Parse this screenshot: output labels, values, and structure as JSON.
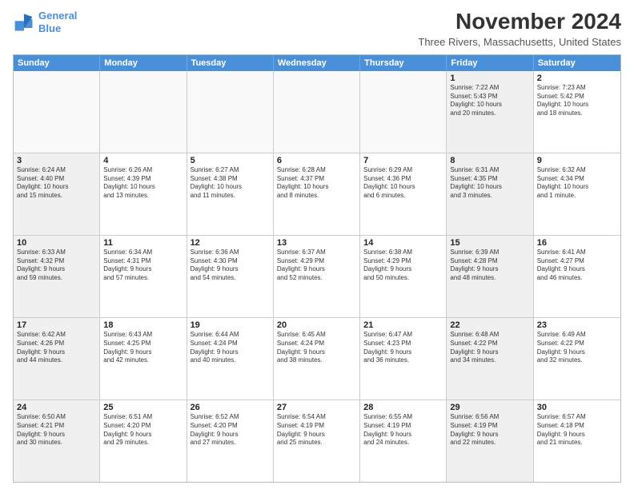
{
  "logo": {
    "line1": "General",
    "line2": "Blue"
  },
  "title": "November 2024",
  "location": "Three Rivers, Massachusetts, United States",
  "weekdays": [
    "Sunday",
    "Monday",
    "Tuesday",
    "Wednesday",
    "Thursday",
    "Friday",
    "Saturday"
  ],
  "rows": [
    [
      {
        "day": "",
        "info": "",
        "shaded": false
      },
      {
        "day": "",
        "info": "",
        "shaded": false
      },
      {
        "day": "",
        "info": "",
        "shaded": false
      },
      {
        "day": "",
        "info": "",
        "shaded": false
      },
      {
        "day": "",
        "info": "",
        "shaded": false
      },
      {
        "day": "1",
        "info": "Sunrise: 7:22 AM\nSunset: 5:43 PM\nDaylight: 10 hours\nand 20 minutes.",
        "shaded": true
      },
      {
        "day": "2",
        "info": "Sunrise: 7:23 AM\nSunset: 5:42 PM\nDaylight: 10 hours\nand 18 minutes.",
        "shaded": false
      }
    ],
    [
      {
        "day": "3",
        "info": "Sunrise: 6:24 AM\nSunset: 4:40 PM\nDaylight: 10 hours\nand 15 minutes.",
        "shaded": true
      },
      {
        "day": "4",
        "info": "Sunrise: 6:26 AM\nSunset: 4:39 PM\nDaylight: 10 hours\nand 13 minutes.",
        "shaded": false
      },
      {
        "day": "5",
        "info": "Sunrise: 6:27 AM\nSunset: 4:38 PM\nDaylight: 10 hours\nand 11 minutes.",
        "shaded": false
      },
      {
        "day": "6",
        "info": "Sunrise: 6:28 AM\nSunset: 4:37 PM\nDaylight: 10 hours\nand 8 minutes.",
        "shaded": false
      },
      {
        "day": "7",
        "info": "Sunrise: 6:29 AM\nSunset: 4:36 PM\nDaylight: 10 hours\nand 6 minutes.",
        "shaded": false
      },
      {
        "day": "8",
        "info": "Sunrise: 6:31 AM\nSunset: 4:35 PM\nDaylight: 10 hours\nand 3 minutes.",
        "shaded": true
      },
      {
        "day": "9",
        "info": "Sunrise: 6:32 AM\nSunset: 4:34 PM\nDaylight: 10 hours\nand 1 minute.",
        "shaded": false
      }
    ],
    [
      {
        "day": "10",
        "info": "Sunrise: 6:33 AM\nSunset: 4:32 PM\nDaylight: 9 hours\nand 59 minutes.",
        "shaded": true
      },
      {
        "day": "11",
        "info": "Sunrise: 6:34 AM\nSunset: 4:31 PM\nDaylight: 9 hours\nand 57 minutes.",
        "shaded": false
      },
      {
        "day": "12",
        "info": "Sunrise: 6:36 AM\nSunset: 4:30 PM\nDaylight: 9 hours\nand 54 minutes.",
        "shaded": false
      },
      {
        "day": "13",
        "info": "Sunrise: 6:37 AM\nSunset: 4:29 PM\nDaylight: 9 hours\nand 52 minutes.",
        "shaded": false
      },
      {
        "day": "14",
        "info": "Sunrise: 6:38 AM\nSunset: 4:29 PM\nDaylight: 9 hours\nand 50 minutes.",
        "shaded": false
      },
      {
        "day": "15",
        "info": "Sunrise: 6:39 AM\nSunset: 4:28 PM\nDaylight: 9 hours\nand 48 minutes.",
        "shaded": true
      },
      {
        "day": "16",
        "info": "Sunrise: 6:41 AM\nSunset: 4:27 PM\nDaylight: 9 hours\nand 46 minutes.",
        "shaded": false
      }
    ],
    [
      {
        "day": "17",
        "info": "Sunrise: 6:42 AM\nSunset: 4:26 PM\nDaylight: 9 hours\nand 44 minutes.",
        "shaded": true
      },
      {
        "day": "18",
        "info": "Sunrise: 6:43 AM\nSunset: 4:25 PM\nDaylight: 9 hours\nand 42 minutes.",
        "shaded": false
      },
      {
        "day": "19",
        "info": "Sunrise: 6:44 AM\nSunset: 4:24 PM\nDaylight: 9 hours\nand 40 minutes.",
        "shaded": false
      },
      {
        "day": "20",
        "info": "Sunrise: 6:45 AM\nSunset: 4:24 PM\nDaylight: 9 hours\nand 38 minutes.",
        "shaded": false
      },
      {
        "day": "21",
        "info": "Sunrise: 6:47 AM\nSunset: 4:23 PM\nDaylight: 9 hours\nand 36 minutes.",
        "shaded": false
      },
      {
        "day": "22",
        "info": "Sunrise: 6:48 AM\nSunset: 4:22 PM\nDaylight: 9 hours\nand 34 minutes.",
        "shaded": true
      },
      {
        "day": "23",
        "info": "Sunrise: 6:49 AM\nSunset: 4:22 PM\nDaylight: 9 hours\nand 32 minutes.",
        "shaded": false
      }
    ],
    [
      {
        "day": "24",
        "info": "Sunrise: 6:50 AM\nSunset: 4:21 PM\nDaylight: 9 hours\nand 30 minutes.",
        "shaded": true
      },
      {
        "day": "25",
        "info": "Sunrise: 6:51 AM\nSunset: 4:20 PM\nDaylight: 9 hours\nand 29 minutes.",
        "shaded": false
      },
      {
        "day": "26",
        "info": "Sunrise: 6:52 AM\nSunset: 4:20 PM\nDaylight: 9 hours\nand 27 minutes.",
        "shaded": false
      },
      {
        "day": "27",
        "info": "Sunrise: 6:54 AM\nSunset: 4:19 PM\nDaylight: 9 hours\nand 25 minutes.",
        "shaded": false
      },
      {
        "day": "28",
        "info": "Sunrise: 6:55 AM\nSunset: 4:19 PM\nDaylight: 9 hours\nand 24 minutes.",
        "shaded": false
      },
      {
        "day": "29",
        "info": "Sunrise: 6:56 AM\nSunset: 4:19 PM\nDaylight: 9 hours\nand 22 minutes.",
        "shaded": true
      },
      {
        "day": "30",
        "info": "Sunrise: 6:57 AM\nSunset: 4:18 PM\nDaylight: 9 hours\nand 21 minutes.",
        "shaded": false
      }
    ]
  ]
}
